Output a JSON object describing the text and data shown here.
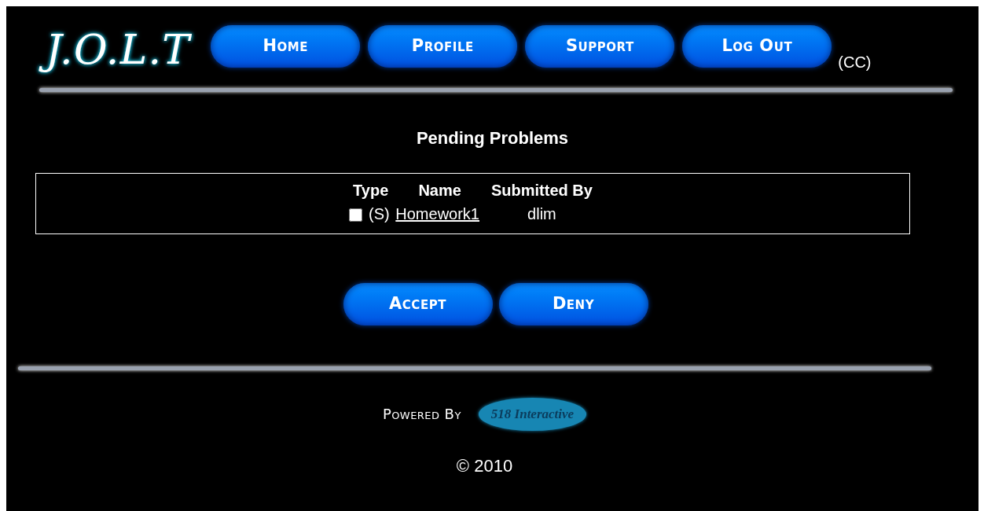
{
  "logo": "J.O.L.T",
  "nav": [
    "Home",
    "Profile",
    "Support",
    "Log Out"
  ],
  "nav_note": "(CC)",
  "heading": "Pending Problems",
  "table": {
    "columns": [
      "Type",
      "Name",
      "Submitted By"
    ],
    "rows": [
      {
        "checked": false,
        "type": "(S)",
        "name": "Homework1",
        "submitted_by": "dlim"
      }
    ]
  },
  "actions": [
    "Accept",
    "Deny"
  ],
  "footer": {
    "powered_by": "Powered By",
    "partner_logo": "518 Interactive",
    "copyright": "© 2010"
  }
}
